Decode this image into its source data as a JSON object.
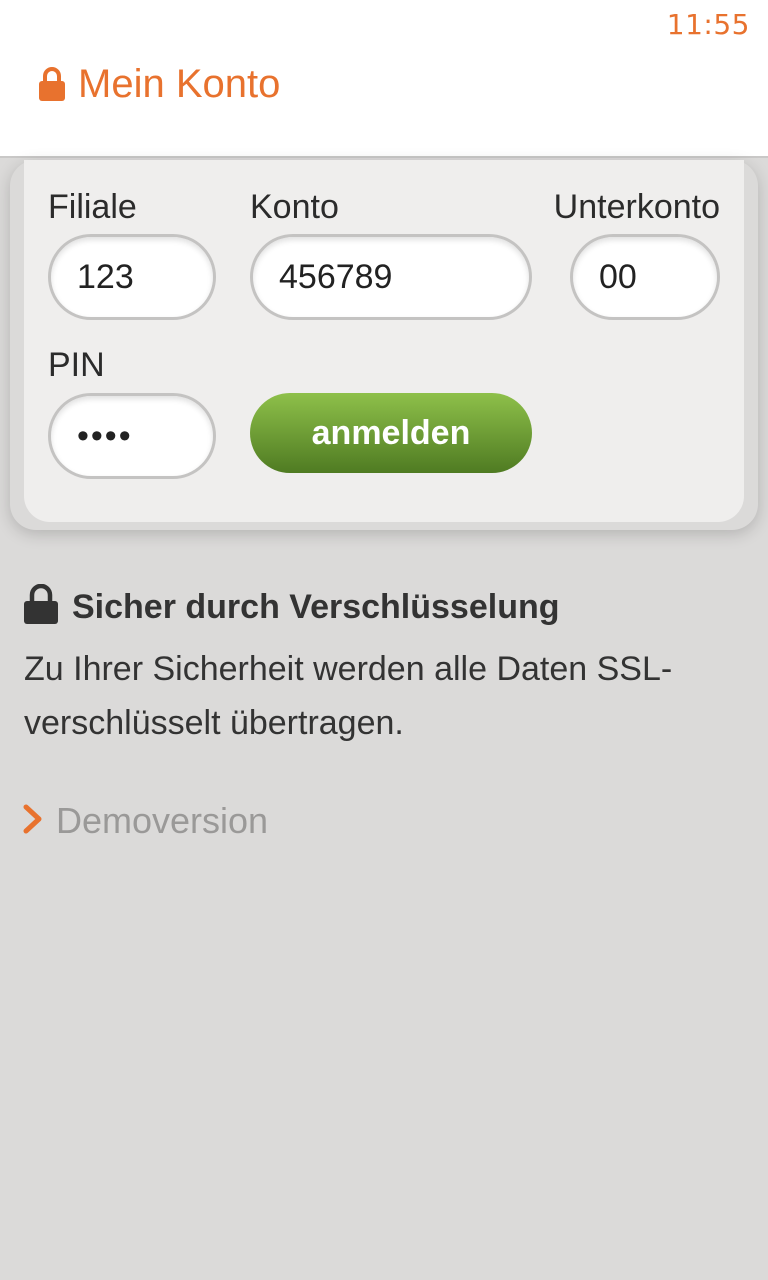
{
  "status_bar": {
    "time": "11:55"
  },
  "header": {
    "title": "Mein Konto",
    "icon": "lock-icon"
  },
  "login_form": {
    "branch_label": "Filiale",
    "branch_value": "123",
    "account_label": "Konto",
    "account_value": "456789",
    "subaccount_label": "Unterkonto",
    "subaccount_value": "00",
    "pin_label": "PIN",
    "pin_value": "••••",
    "login_button": "anmelden"
  },
  "security": {
    "title": "Sicher durch Verschlüsselung",
    "text": "Zu Ihrer Sicherheit werden alle Daten SSL-verschlüsselt übertragen."
  },
  "demo": {
    "label": "Demoversion"
  },
  "colors": {
    "accent": "#e8722e",
    "button_top": "#8ec04a",
    "button_bottom": "#4f7b22",
    "background": "#dbdad9",
    "panel": "#efeeed"
  }
}
